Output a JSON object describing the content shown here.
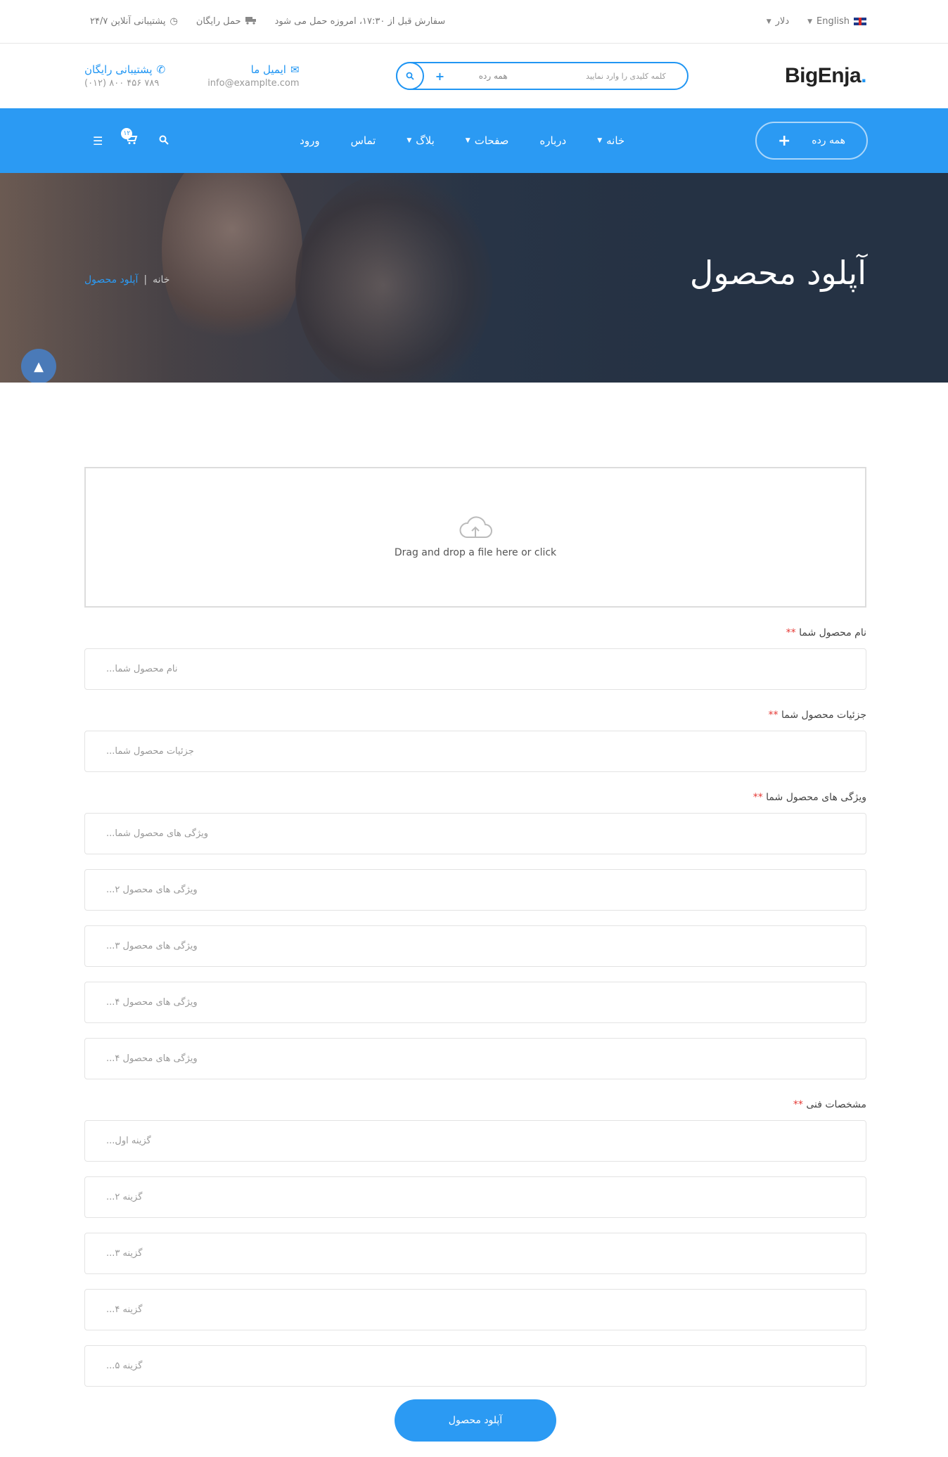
{
  "topbar": {
    "language": "English",
    "currency": "دلار",
    "order_notice": "سفارش قبل از ۱۷:۳۰، امروزه حمل می شود",
    "free_shipping": "حمل رایگان",
    "support": "۲۴/۷ پشتیبانی آنلاین"
  },
  "header": {
    "logo": "BigEnja",
    "logo_dot": ".",
    "search_placeholder": "کلمه کلیدی را وارد نمایید",
    "search_category": "همه رده",
    "email_title": "ایمیل ما",
    "email_value": "info@examplte.com",
    "support_title": "پشتیبانی رایگان",
    "support_phone": "(۰۱۲) ۸۰۰ ۴۵۶ ۷۸۹"
  },
  "nav": {
    "all_categories": "همه رده",
    "cart_count": "۱۲",
    "items": [
      {
        "label": "خانه",
        "dropdown": true
      },
      {
        "label": "درباره",
        "dropdown": false
      },
      {
        "label": "صفحات",
        "dropdown": true
      },
      {
        "label": "بلاگ",
        "dropdown": true
      },
      {
        "label": "تماس",
        "dropdown": false
      },
      {
        "label": "ورود",
        "dropdown": false
      }
    ]
  },
  "hero": {
    "title": "آپلود محصول",
    "breadcrumb_home": "خانه",
    "breadcrumb_sep": "|",
    "breadcrumb_current": "آپلود محصول"
  },
  "form": {
    "dropzone_text": "Drag and drop a file here or click",
    "required_mark": "**",
    "name_label": "نام محصول شما",
    "name_placeholder": "نام محصول شما...",
    "details_label": "جزئیات محصول شما",
    "details_placeholder": "جزئیات محصول شما...",
    "features_label": "ویژگی های محصول شما",
    "features": [
      "ویژگی های محصول شما...",
      "ویژگی های محصول ۲...",
      "ویژگی های محصول ۳...",
      "ویژگی های محصول ۴...",
      "ویژگی های محصول ۴..."
    ],
    "specs_label": "مشخصات فنی",
    "specs": [
      "گزینه اول...",
      "گزینه ۲...",
      "گزینه ۳...",
      "گزینه ۴...",
      "گزینه ۵..."
    ],
    "submit_label": "آپلود محصول"
  },
  "colors": {
    "accent": "#2b9af3",
    "hero_dark": "#253244",
    "required": "#e53935"
  }
}
